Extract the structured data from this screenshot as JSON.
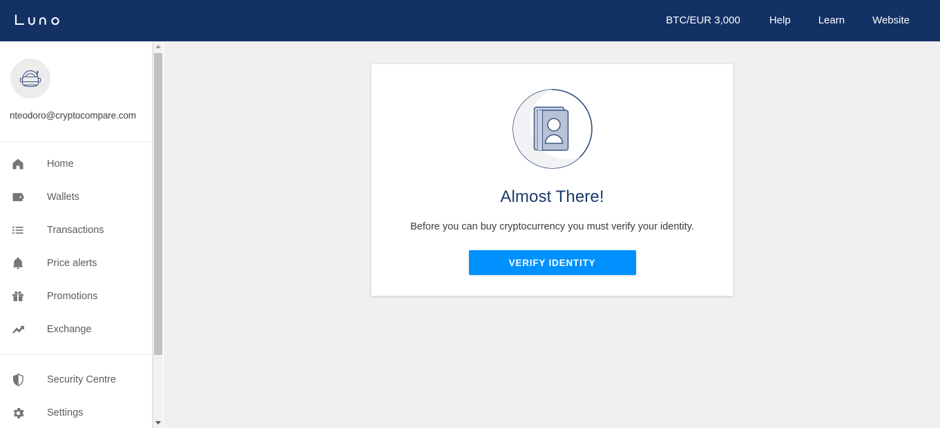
{
  "header": {
    "logo_text": "luno",
    "logo_icon": "luno-wordmark",
    "nav": [
      {
        "label": "BTC/EUR 3,000",
        "name": "price-ticker"
      },
      {
        "label": "Help",
        "name": "nav-help"
      },
      {
        "label": "Learn",
        "name": "nav-learn"
      },
      {
        "label": "Website",
        "name": "nav-website"
      }
    ],
    "background_color": "#133165"
  },
  "sidebar": {
    "avatar_icon": "astronaut-helmet-icon",
    "email": "nteodoro@cryptocompare.com",
    "primary_items": [
      {
        "label": "Home",
        "icon": "home-icon"
      },
      {
        "label": "Wallets",
        "icon": "wallet-icon"
      },
      {
        "label": "Transactions",
        "icon": "list-icon"
      },
      {
        "label": "Price alerts",
        "icon": "bell-icon"
      },
      {
        "label": "Promotions",
        "icon": "gift-icon"
      },
      {
        "label": "Exchange",
        "icon": "trending-up-icon"
      }
    ],
    "secondary_items": [
      {
        "label": "Security Centre",
        "icon": "shield-icon"
      },
      {
        "label": "Settings",
        "icon": "gear-icon"
      }
    ],
    "scrollbar": {
      "up_arrow_icon": "scroll-up-arrow-icon",
      "down_arrow_icon": "scroll-down-arrow-icon"
    }
  },
  "main": {
    "card": {
      "illustration_icon": "id-document-person-icon",
      "title": "Almost There!",
      "body": "Before you can buy cryptocurrency you must verify your identity.",
      "button_label": "VERIFY IDENTITY",
      "button_color": "#0091ff",
      "title_color": "#1b3a6b"
    },
    "background_color": "#f0f0f0"
  }
}
